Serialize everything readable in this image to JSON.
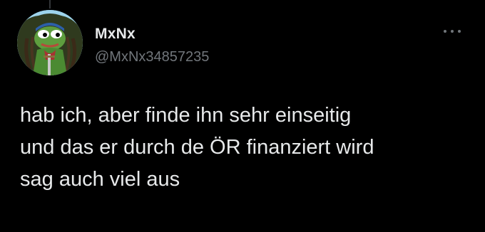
{
  "tweet": {
    "author": {
      "display_name": "MxNx",
      "handle": "@MxNx34857235",
      "avatar_icon": "pepe-frog-avatar"
    },
    "more_icon": "more-horizontal-icon",
    "text_lines": [
      "hab ich, aber finde ihn sehr einseitig",
      "und das er durch de ÖR finanziert wird",
      "sag auch viel aus"
    ]
  },
  "colors": {
    "background": "#000000",
    "primary_text": "#e7e9ea",
    "secondary_text": "#71767b",
    "thread_line": "#333639"
  }
}
